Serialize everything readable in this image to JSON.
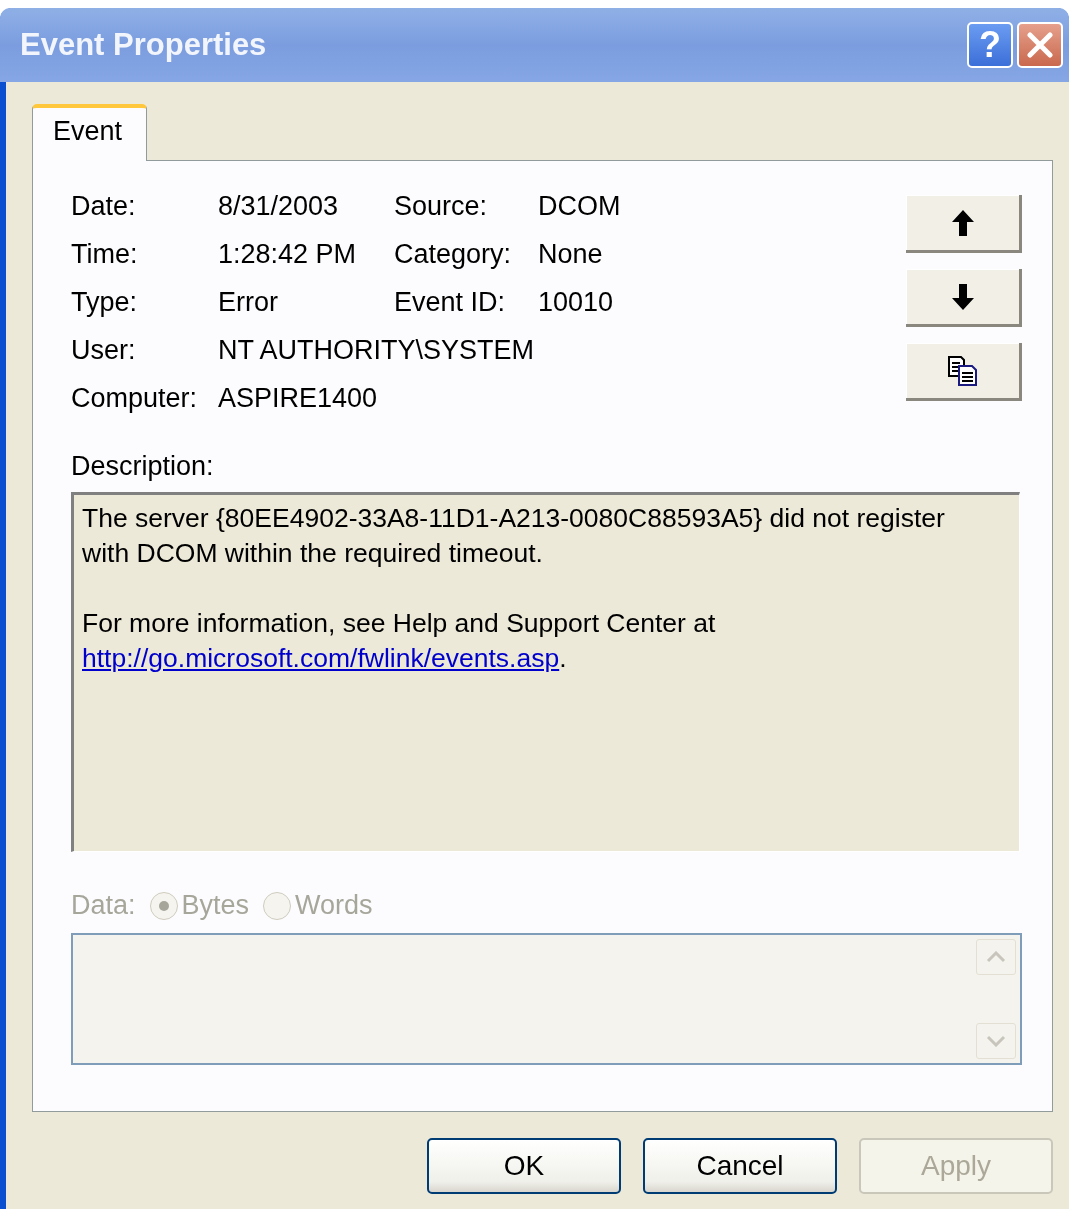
{
  "window": {
    "title": "Event Properties",
    "help_glyph": "?"
  },
  "tabs": [
    {
      "label": "Event",
      "selected": true
    }
  ],
  "fields_left": [
    {
      "label": "Date:",
      "value": "8/31/2003"
    },
    {
      "label": "Time:",
      "value": "1:28:42 PM"
    },
    {
      "label": "Type:",
      "value": "Error"
    },
    {
      "label": "User:",
      "value": "NT AUTHORITY\\SYSTEM"
    },
    {
      "label": "Computer:",
      "value": "ASPIRE1400"
    }
  ],
  "fields_right": [
    {
      "label": "Source:",
      "value": "DCOM"
    },
    {
      "label": "Category:",
      "value": "None"
    },
    {
      "label": "Event ID:",
      "value": "10010"
    }
  ],
  "nav_buttons": [
    {
      "kind": "up"
    },
    {
      "kind": "down"
    },
    {
      "kind": "copy"
    }
  ],
  "description": {
    "label": "Description:",
    "paragraphs": [
      {
        "text": "The server {80EE4902-33A8-11D1-A213-0080C88593A5} did not register with DCOM within the required timeout."
      },
      {
        "text": "For more information, see Help and Support Center at",
        "link": "http://go.microsoft.com/fwlink/events.asp",
        "after": "."
      }
    ]
  },
  "data": {
    "label": "Data:",
    "disabled": true,
    "options": [
      {
        "label": "Bytes",
        "selected": true
      },
      {
        "label": "Words",
        "selected": false
      }
    ]
  },
  "buttons": [
    {
      "label": "OK",
      "disabled": false
    },
    {
      "label": "Cancel",
      "disabled": false
    },
    {
      "label": "Apply",
      "disabled": true
    }
  ]
}
